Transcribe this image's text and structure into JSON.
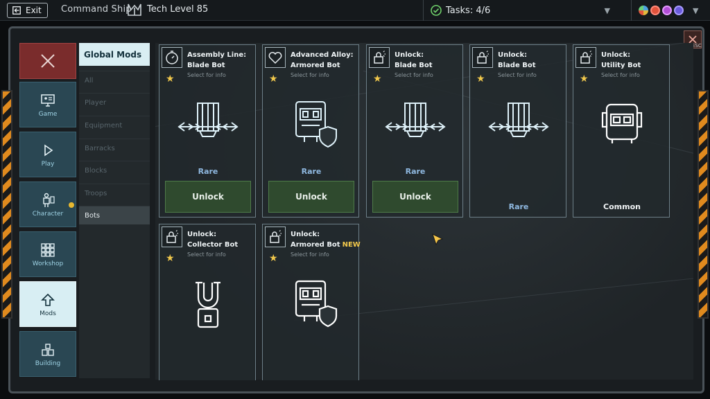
{
  "topbar": {
    "exit_label": "Exit",
    "ship_title": "Command Ship",
    "tech_level": "Tech Level 85",
    "tasks": "Tasks: 4/6",
    "resources": [
      "#4ea3e0",
      "#e0533c",
      "#b14fd6",
      "#6a5bdc"
    ]
  },
  "leftnav": {
    "items": [
      {
        "label": "Game",
        "icon": "monitor-icon"
      },
      {
        "label": "Play",
        "icon": "play-icon"
      },
      {
        "label": "Character",
        "icon": "character-icon"
      },
      {
        "label": "Workshop",
        "icon": "grid-icon"
      },
      {
        "label": "Mods",
        "icon": "arrow-up-icon",
        "active": true
      },
      {
        "label": "Building",
        "icon": "building-icon"
      }
    ]
  },
  "subnav": {
    "header": "Global Mods",
    "items": [
      "All",
      "Player",
      "Equipment",
      "Barracks",
      "Blocks",
      "Troops",
      "Bots"
    ],
    "active": "Bots"
  },
  "cards": [
    {
      "title1": "Assembly Line:",
      "title2": "Blade Bot",
      "sub": "Select for info",
      "icon": "timer-icon",
      "art": "blade-bot",
      "rarity": "Rare",
      "button": "Unlock"
    },
    {
      "title1": "Advanced Alloy:",
      "title2": "Armored Bot",
      "sub": "Select for info",
      "icon": "heart-icon",
      "art": "armored-bot",
      "rarity": "Rare",
      "button": "Unlock"
    },
    {
      "title1": "Unlock:",
      "title2": "Blade Bot",
      "sub": "Select for info",
      "icon": "lock-icon",
      "art": "blade-bot",
      "rarity": "Rare",
      "button": "Unlock"
    },
    {
      "title1": "Unlock:",
      "title2": "Blade Bot",
      "sub": "Select for info",
      "icon": "lock-icon",
      "art": "blade-bot",
      "rarity": "Rare"
    },
    {
      "title1": "Unlock:",
      "title2": "Utility Bot",
      "sub": "Select for info",
      "icon": "lock-icon",
      "art": "utility-bot",
      "rarity": "Common"
    },
    {
      "title1": "Unlock:",
      "title2": "Collector Bot",
      "sub": "Select for info",
      "icon": "lock-icon",
      "art": "collector-bot"
    },
    {
      "title1": "Unlock:",
      "title2": "Armored Bot",
      "title_badge": "NEW",
      "sub": "Select for info",
      "icon": "lock-icon",
      "art": "armored-bot"
    }
  ],
  "esc_label": "ESC"
}
